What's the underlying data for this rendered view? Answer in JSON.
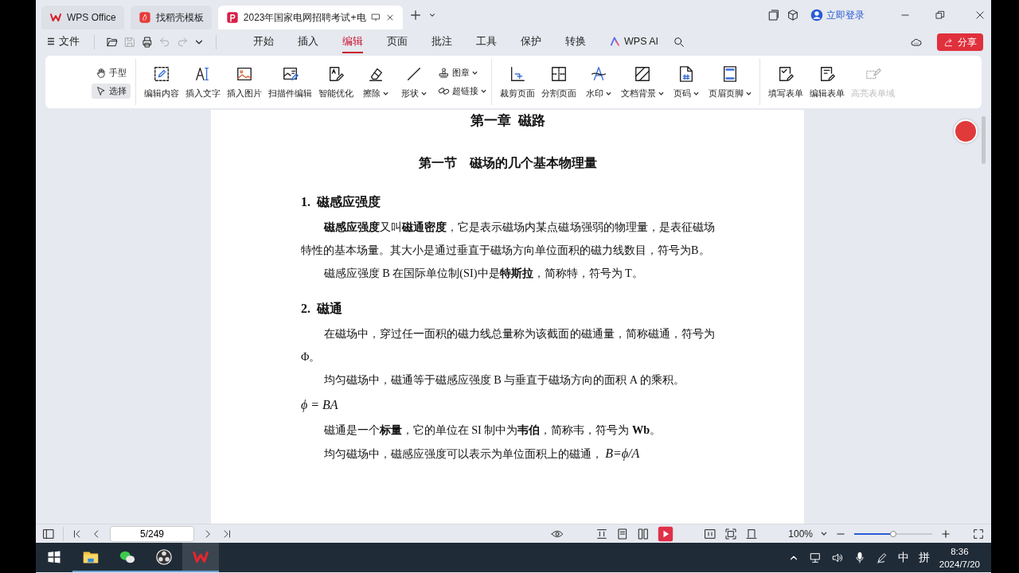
{
  "tabs": [
    {
      "kind": "wps",
      "label": "WPS Office",
      "selected": false
    },
    {
      "kind": "docer",
      "label": "找稻壳模板",
      "selected": false
    },
    {
      "kind": "pdf",
      "label": "2023年国家电网招聘考试+电",
      "selected": true
    }
  ],
  "account": {
    "login": "立即登录"
  },
  "menu": {
    "file": "文件",
    "tabs": [
      {
        "label": "开始",
        "selected": false
      },
      {
        "label": "插入",
        "selected": false
      },
      {
        "label": "编辑",
        "selected": true
      },
      {
        "label": "页面",
        "selected": false
      },
      {
        "label": "批注",
        "selected": false
      },
      {
        "label": "工具",
        "selected": false
      },
      {
        "label": "保护",
        "selected": false
      },
      {
        "label": "转换",
        "selected": false
      }
    ],
    "ai": "WPS AI",
    "share": "分享"
  },
  "ribbon": {
    "modes": [
      {
        "label": "手型",
        "kind": "hand",
        "selected": false
      },
      {
        "label": "选择",
        "kind": "cursor",
        "selected": true
      }
    ],
    "groups": [
      {
        "items": [
          {
            "kind": "edit",
            "label": "编辑内容",
            "dropdown": false,
            "disabled": false
          },
          {
            "kind": "text",
            "label": "插入文字",
            "dropdown": false,
            "disabled": false
          },
          {
            "kind": "image",
            "label": "插入图片",
            "dropdown": false,
            "disabled": false
          },
          {
            "kind": "scan",
            "label": "扫描件编辑",
            "dropdown": false,
            "disabled": false
          },
          {
            "kind": "smart",
            "label": "智能优化",
            "dropdown": false,
            "disabled": false
          },
          {
            "kind": "eraser",
            "label": "擦除",
            "dropdown": true,
            "disabled": false
          },
          {
            "kind": "line",
            "label": "形状",
            "dropdown": true,
            "disabled": false
          }
        ],
        "stacked": [
          {
            "kind": "stamp",
            "label": "图章",
            "dropdown": true
          },
          {
            "kind": "link",
            "label": "超链接",
            "dropdown": true
          }
        ]
      },
      {
        "items": [
          {
            "kind": "crop",
            "label": "裁剪页面",
            "dropdown": false,
            "disabled": false
          },
          {
            "kind": "split",
            "label": "分割页面",
            "dropdown": false,
            "disabled": false
          },
          {
            "kind": "watermark",
            "label": "水印",
            "dropdown": true,
            "disabled": false
          },
          {
            "kind": "background",
            "label": "文档背景",
            "dropdown": true,
            "disabled": false
          },
          {
            "kind": "pagenum",
            "label": "页码",
            "dropdown": true,
            "disabled": false
          },
          {
            "kind": "header",
            "label": "页眉页脚",
            "dropdown": true,
            "disabled": false
          }
        ]
      },
      {
        "items": [
          {
            "kind": "fill",
            "label": "填写表单",
            "dropdown": false,
            "disabled": false
          },
          {
            "kind": "form",
            "label": "编辑表单",
            "dropdown": false,
            "disabled": false
          },
          {
            "kind": "highlight",
            "label": "高亮表单域",
            "dropdown": false,
            "disabled": true
          }
        ]
      }
    ]
  },
  "document": {
    "chapter": "第一章  磁路",
    "section": "第一节    磁场的几个基本物理量",
    "blocks": [
      {
        "kind": "heading",
        "text": "1.  磁感应强度"
      },
      {
        "kind": "para",
        "text": "**磁感应强度**又叫**磁通密度**，它是表示磁场内某点磁场强弱的物理量，是表征磁场特性的基本场量。其大小是通过垂直于磁场方向单位面积的磁力线数目，符号为B。"
      },
      {
        "kind": "para",
        "text": "磁感应强度 B 在国际单位制(SI)中是**特斯拉**，简称特，符号为 T。"
      },
      {
        "kind": "heading",
        "text": "2.  磁通"
      },
      {
        "kind": "para",
        "text": "在磁场中，穿过任一面积的磁力线总量称为该截面的磁通量，简称磁通，符号为Φ。"
      },
      {
        "kind": "para",
        "text": "均匀磁场中，磁通等于磁感应强度 B 与垂直于磁场方向的面积 A 的乘积。"
      },
      {
        "kind": "formula",
        "text": "ϕ = BA"
      },
      {
        "kind": "para",
        "text": "磁通是一个**标量**，它的单位在 SI 制中为**韦伯**，简称韦，符号为 **Wb**。"
      },
      {
        "kind": "para",
        "text": "均匀磁场中，磁感应强度可以表示为单位面积上的磁通，",
        "formula": "B=ϕ/A"
      }
    ]
  },
  "status": {
    "page": "5/249",
    "zoom": "100%",
    "zoom_slider": {
      "level": 0.5
    }
  },
  "taskbar": {
    "apps": [
      {
        "kind": "start",
        "selected": false
      },
      {
        "kind": "folder",
        "selected": false
      },
      {
        "kind": "chat",
        "selected": false
      },
      {
        "kind": "recorder",
        "selected": false
      },
      {
        "kind": "wps",
        "selected": true
      }
    ],
    "ime": "中",
    "ime_mode": "拼",
    "time": "8:36",
    "date": "2024/7/20"
  }
}
